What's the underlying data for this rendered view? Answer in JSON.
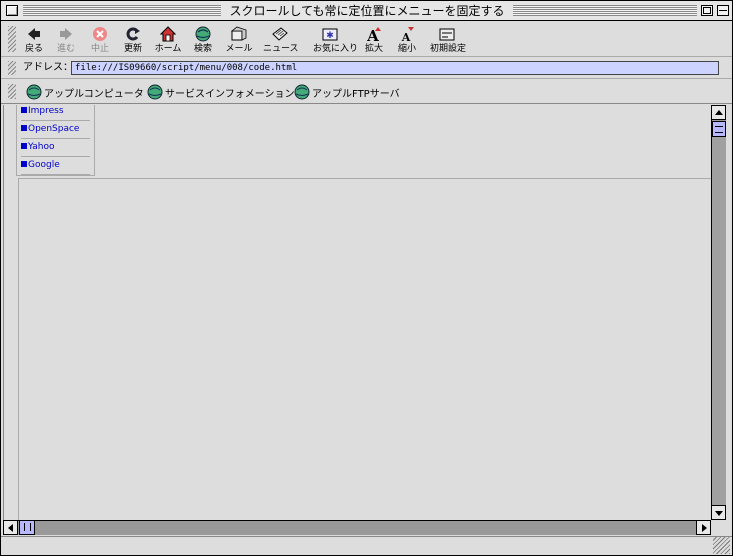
{
  "window": {
    "title": "スクロールしても常に定位置にメニューを固定する"
  },
  "toolbar": {
    "buttons": [
      {
        "label": "戻る",
        "icon": "back-arrow-icon",
        "enabled": true
      },
      {
        "label": "進む",
        "icon": "forward-arrow-icon",
        "enabled": false
      },
      {
        "label": "中止",
        "icon": "stop-icon",
        "enabled": false
      },
      {
        "label": "更新",
        "icon": "refresh-icon",
        "enabled": true
      },
      {
        "label": "ホーム",
        "icon": "home-icon",
        "enabled": true
      },
      {
        "label": "検索",
        "icon": "search-globe-icon",
        "enabled": true
      },
      {
        "label": "メール",
        "icon": "mail-icon",
        "enabled": true
      },
      {
        "label": "ニュース",
        "icon": "news-icon",
        "enabled": true
      },
      {
        "label": "お気に入り",
        "icon": "favorites-icon",
        "enabled": true
      },
      {
        "label": "拡大",
        "icon": "text-larger-icon",
        "enabled": true
      },
      {
        "label": "縮小",
        "icon": "text-smaller-icon",
        "enabled": true
      },
      {
        "label": "初期設定",
        "icon": "preferences-icon",
        "enabled": true
      }
    ]
  },
  "address": {
    "label": "アドレス：",
    "value": "file:///IS09660/script/menu/008/code.html"
  },
  "favorites": [
    {
      "label": "アップルコンピュータ"
    },
    {
      "label": "サービスインフォメーション"
    },
    {
      "label": "アップルFTPサーバ"
    }
  ],
  "menu": {
    "items": [
      {
        "label": "Impress"
      },
      {
        "label": "OpenSpace"
      },
      {
        "label": "Yahoo"
      },
      {
        "label": "Google"
      }
    ]
  },
  "colors": {
    "window_bg": "#dddddd",
    "address_bg": "#ccd3ff",
    "link": "#0000cc",
    "scroll_thumb": "#b8b8ff"
  }
}
